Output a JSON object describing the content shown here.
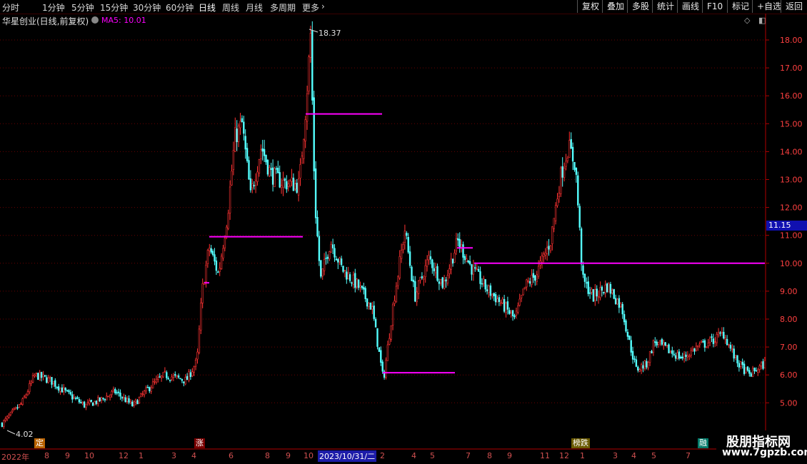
{
  "toolbar": {
    "periods": [
      "分时",
      "1分钟",
      "5分钟",
      "15分钟",
      "30分钟",
      "60分钟",
      "日线",
      "周线",
      "月线",
      "多周期",
      "更多"
    ],
    "active_period": "日线",
    "more_arrow": "›",
    "right_buttons": [
      "复权",
      "叠加",
      "多股",
      "统计",
      "画线",
      "F10",
      "标记",
      "+自选",
      "返回"
    ]
  },
  "header": {
    "title": "华星创业(日线,前复权)",
    "ma_label": "MA5: 10.01",
    "icons": [
      "diamond-icon",
      "square-icon"
    ]
  },
  "price_tag": "11.15",
  "extremes": {
    "high_label": "18.37",
    "low_label": "4.02"
  },
  "events": [
    "定",
    "涨",
    "榜跌",
    "融"
  ],
  "x_axis": {
    "labels": [
      "2022年",
      "8",
      "9",
      "10",
      "12",
      "1",
      "3",
      "4",
      "6",
      "8",
      "9",
      "10",
      "2",
      "4",
      "5",
      "7",
      "8",
      "9",
      "11",
      "12",
      "1",
      "3",
      "4",
      "5",
      "7"
    ],
    "selected": "2023/10/31/二"
  },
  "chart_data": {
    "type": "candlestick",
    "ylim": [
      4.0,
      18.6
    ],
    "yticks": [
      "5.00",
      "6.00",
      "7.00",
      "8.00",
      "9.00",
      "10.00",
      "11.00",
      "12.00",
      "13.00",
      "14.00",
      "15.00",
      "16.00",
      "17.00",
      "18.00"
    ],
    "close_path": [
      [
        0,
        4.2
      ],
      [
        30,
        5.0
      ],
      [
        48,
        6.0
      ],
      [
        70,
        5.8
      ],
      [
        95,
        5.3
      ],
      [
        118,
        4.9
      ],
      [
        140,
        5.1
      ],
      [
        160,
        5.4
      ],
      [
        185,
        4.9
      ],
      [
        210,
        5.6
      ],
      [
        230,
        6.0
      ],
      [
        260,
        5.8
      ],
      [
        275,
        6.5
      ],
      [
        282,
        9.0
      ],
      [
        292,
        10.6
      ],
      [
        305,
        9.6
      ],
      [
        318,
        11.8
      ],
      [
        328,
        14.5
      ],
      [
        338,
        15.0
      ],
      [
        350,
        12.4
      ],
      [
        365,
        14.2
      ],
      [
        378,
        13.2
      ],
      [
        395,
        12.9
      ],
      [
        418,
        12.8
      ],
      [
        428,
        15.8
      ],
      [
        434,
        18.2
      ],
      [
        440,
        12.2
      ],
      [
        448,
        9.4
      ],
      [
        462,
        10.8
      ],
      [
        478,
        9.8
      ],
      [
        500,
        9.2
      ],
      [
        520,
        8.4
      ],
      [
        536,
        5.8
      ],
      [
        550,
        8.6
      ],
      [
        566,
        11.2
      ],
      [
        580,
        8.8
      ],
      [
        600,
        10.2
      ],
      [
        620,
        9.2
      ],
      [
        640,
        10.8
      ],
      [
        660,
        9.8
      ],
      [
        680,
        9.1
      ],
      [
        700,
        8.6
      ],
      [
        720,
        8.0
      ],
      [
        735,
        9.2
      ],
      [
        750,
        9.6
      ],
      [
        770,
        10.8
      ],
      [
        783,
        13.0
      ],
      [
        795,
        14.2
      ],
      [
        805,
        13.5
      ],
      [
        815,
        9.4
      ],
      [
        830,
        8.8
      ],
      [
        850,
        9.2
      ],
      [
        870,
        8.4
      ],
      [
        880,
        7.2
      ],
      [
        890,
        6.2
      ],
      [
        905,
        6.4
      ],
      [
        915,
        7.2
      ],
      [
        940,
        6.8
      ],
      [
        955,
        6.6
      ],
      [
        975,
        7.0
      ],
      [
        995,
        7.2
      ],
      [
        1012,
        7.5
      ],
      [
        1030,
        6.5
      ],
      [
        1048,
        6.0
      ],
      [
        1070,
        6.4
      ]
    ],
    "level_lines": [
      {
        "x0": 286,
        "x1": 293,
        "y": 9.3
      },
      {
        "x0": 293,
        "x1": 424,
        "y": 10.95
      },
      {
        "x0": 428,
        "x1": 535,
        "y": 15.35
      },
      {
        "x0": 536,
        "x1": 637,
        "y": 6.08
      },
      {
        "x0": 640,
        "x1": 662,
        "y": 10.55
      },
      {
        "x0": 664,
        "x1": 1071,
        "y": 10.0
      }
    ],
    "colors": {
      "up": "#ff3232",
      "down": "#54ffff",
      "level": "#ff00ff",
      "grid": "#6a0000",
      "axis": "#b00000"
    }
  }
}
